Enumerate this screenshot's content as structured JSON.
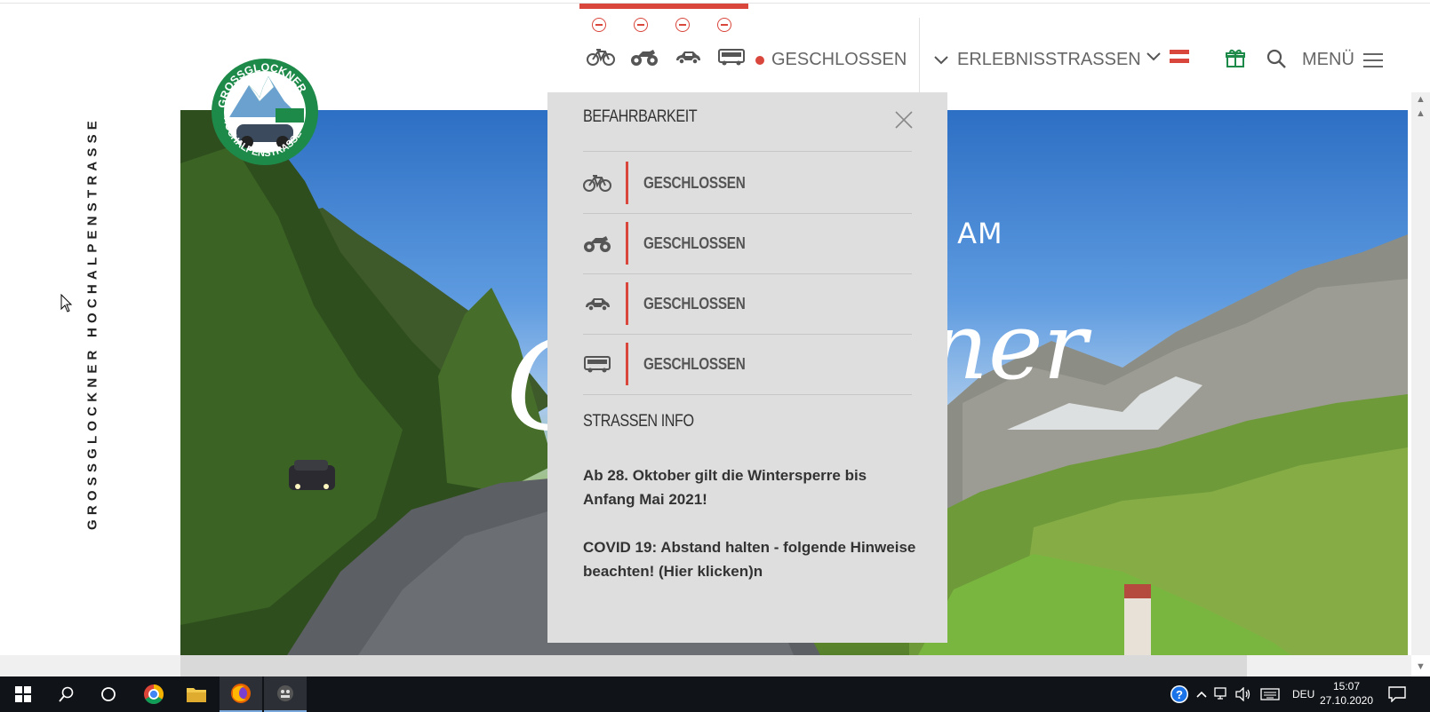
{
  "site": {
    "side_title": "GROSSGLOCKNER HOCHALPENSTRASSE",
    "logo": {
      "arc_top": "GROSSGLOCKNER",
      "arc_bottom": "HOCHALPENSTRASSE"
    }
  },
  "header": {
    "status_label": "GESCHLOSSEN",
    "erlebnis_label": "ERLEBNISSTRASSEN",
    "menu_label": "MENÜ",
    "vehicles": [
      "bicycle-icon",
      "motorcycle-icon",
      "car-icon",
      "bus-icon"
    ]
  },
  "hero": {
    "headline_fragment": "N AM",
    "script_fragment_left": "G",
    "script_fragment_right": "ner"
  },
  "popup": {
    "title": "BEFAHRBARKEIT",
    "rows": [
      {
        "icon": "bicycle-icon",
        "status": "GESCHLOSSEN"
      },
      {
        "icon": "motorcycle-icon",
        "status": "GESCHLOSSEN"
      },
      {
        "icon": "car-icon",
        "status": "GESCHLOSSEN"
      },
      {
        "icon": "bus-icon",
        "status": "GESCHLOSSEN"
      }
    ],
    "info_title": "STRASSEN INFO",
    "info_1": "Ab 28. Oktober gilt die Wintersperre bis Anfang Mai 2021!",
    "info_2": "COVID 19: Abstand halten - folgende Hinweise beachten! (Hier klicken)n"
  },
  "taskbar": {
    "lang": "DEU",
    "time": "15:07",
    "date": "27.10.2020"
  },
  "colors": {
    "accent": "#d9463b",
    "green": "#1e8a4a",
    "popup_bg": "#dedede",
    "taskbar_bg": "#101317"
  }
}
